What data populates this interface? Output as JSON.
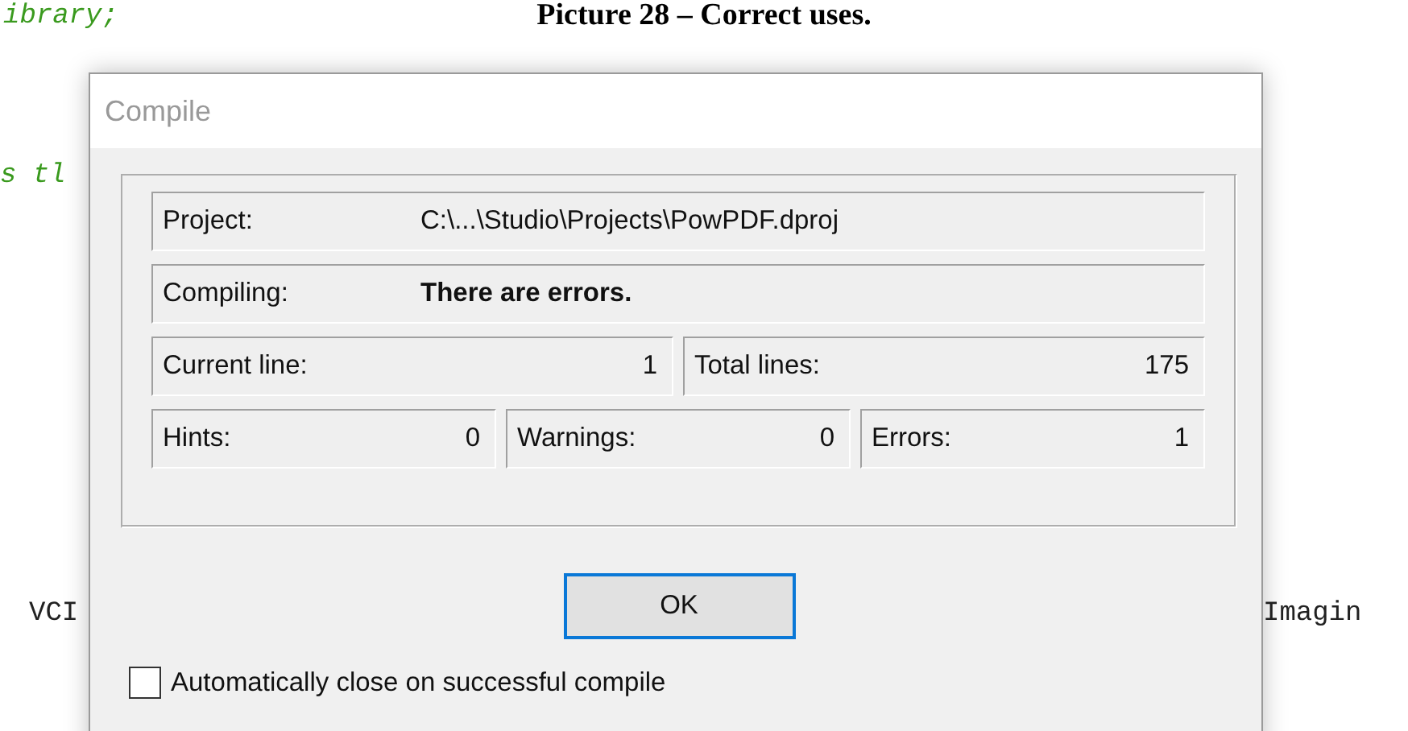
{
  "document": {
    "caption": "Picture 28 – Correct uses.",
    "code_fragments": [
      {
        "text": "ibrary;",
        "kind": "comment"
      },
      {
        "text": "s tl",
        "kind": "comment"
      },
      {
        "text": "VCI",
        "kind": "code"
      },
      {
        "text": "Imagin",
        "kind": "code"
      }
    ]
  },
  "dialog": {
    "title": "Compile",
    "rows": [
      [
        {
          "label": "Project:",
          "value": "C:\\...\\Studio\\Projects\\PowPDF.dproj",
          "kind": "wide",
          "bold": false
        }
      ],
      [
        {
          "label": "Compiling:",
          "value": "There are errors.",
          "kind": "wide",
          "bold": true
        }
      ],
      [
        {
          "label": "Current line:",
          "value": "1",
          "kind": "count",
          "bold": false
        },
        {
          "label": "Total lines:",
          "value": "175",
          "kind": "count",
          "bold": false
        }
      ],
      [
        {
          "label": "Hints:",
          "value": "0",
          "kind": "count",
          "bold": false
        },
        {
          "label": "Warnings:",
          "value": "0",
          "kind": "count",
          "bold": false
        },
        {
          "label": "Errors:",
          "value": "1",
          "kind": "count",
          "bold": false
        }
      ]
    ],
    "ok_button": "OK",
    "auto_close": {
      "label": "Automatically close on successful compile",
      "checked": false
    }
  }
}
